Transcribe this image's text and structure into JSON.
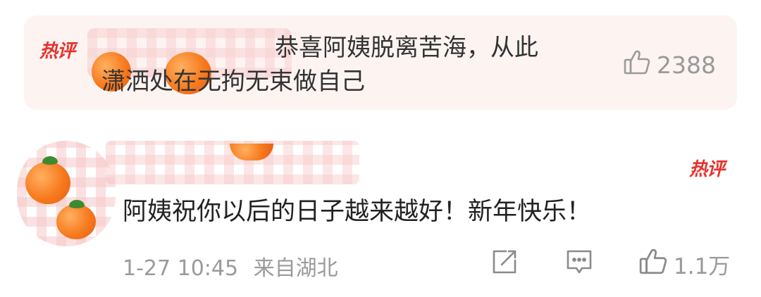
{
  "top_comment": {
    "badge": "热评",
    "text_line1": "恭喜阿姨脱离苦海，从此",
    "text_line2": "潇洒处在无拘无束做自己",
    "likes": "2388"
  },
  "second_comment": {
    "badge": "热评",
    "text": "阿姨祝你以后的日子越来越好！新年快乐！",
    "timestamp": "1-27 10:45",
    "location": "来自湖北",
    "likes": "1.1万"
  },
  "icons": {
    "like": "thumbs-up-icon",
    "share": "share-icon",
    "comment": "comment-icon"
  },
  "colors": {
    "badge_red": "#e6322e",
    "card_bg": "#fdf4f2",
    "meta_gray": "#9a9a9a"
  }
}
